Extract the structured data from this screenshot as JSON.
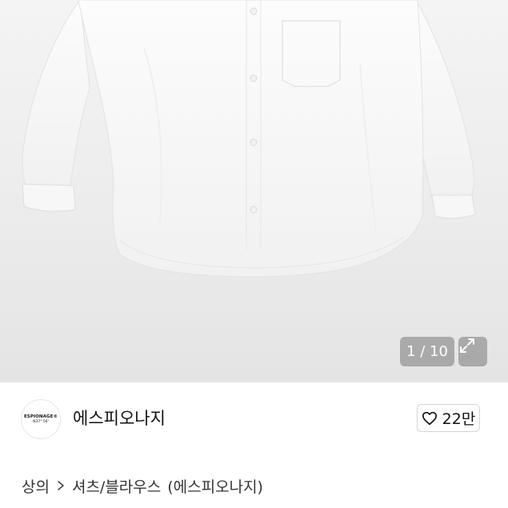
{
  "gallery": {
    "counter": "1 / 10",
    "expand_icon": "expand-icon",
    "image_subject": "white-shirt"
  },
  "shop": {
    "logo_line1": "ESPIONAGE®",
    "logo_line2": "N37° 56'",
    "name": "에스피오나지",
    "like_icon": "heart-icon",
    "likes": "22만"
  },
  "breadcrumb": {
    "category": "상의",
    "separator_icon": "chevron-right-icon",
    "subcategory": "셔츠/블라우스",
    "brand": "(에스피오나지)"
  },
  "colors": {
    "background": "#ffffff",
    "hero_background": "#ececec",
    "text": "#111111",
    "overlay": "#787878"
  }
}
